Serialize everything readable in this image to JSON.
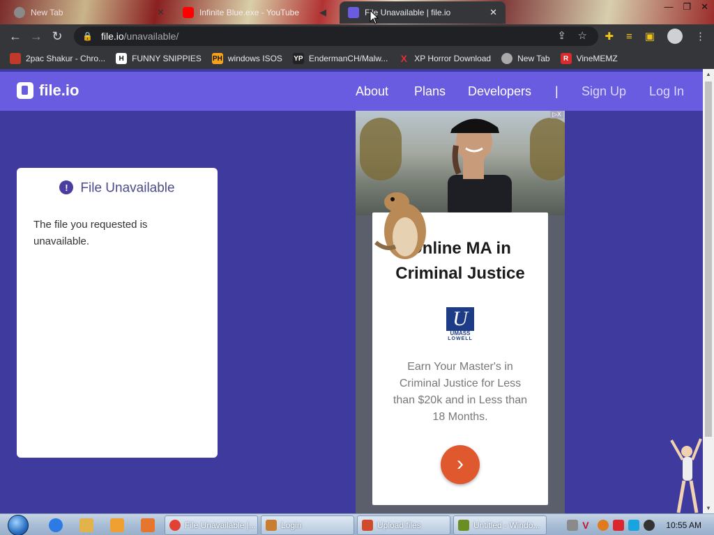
{
  "browser": {
    "tabs": [
      {
        "title": "New Tab",
        "active": false
      },
      {
        "title": "Infinite Blue.exe - YouTube",
        "active": false
      },
      {
        "title": "File Unavailable | file.io",
        "active": true
      }
    ],
    "close_glyph": "✕",
    "url_host": "file.io",
    "url_path": "/unavailable/",
    "bookmarks": [
      {
        "label": "2pac Shakur - Chro...",
        "icon": "bookmark-icon",
        "color": "#c0392b"
      },
      {
        "label": "FUNNY SNIPPIES",
        "icon": "H",
        "color": "#ffffff"
      },
      {
        "label": "windows ISOS",
        "icon": "PH",
        "color": "#f7a21b"
      },
      {
        "label": "EndermanCH/Malw...",
        "icon": "YP",
        "color": "#222222"
      },
      {
        "label": "XP Horror Download",
        "icon": "X",
        "color": "#e03030"
      },
      {
        "label": "New Tab",
        "icon": "globe-icon",
        "color": "#aaaaaa"
      },
      {
        "label": "VineMEMZ",
        "icon": "R",
        "color": "#d92b2b"
      }
    ]
  },
  "site": {
    "logo": "file.io",
    "nav": [
      "About",
      "Plans",
      "Developers",
      "|",
      "Sign Up",
      "Log In"
    ],
    "error_card": {
      "title": "File Unavailable",
      "message": "The file you requested is unavailable."
    }
  },
  "ad": {
    "adchoice": "▷X",
    "title_line1": "Online MA in",
    "title_line2": "Criminal Justice",
    "logo_top": "UMASS",
    "logo_bottom": "LOWELL",
    "logo_glyph": "U",
    "description": "Earn Your Master's in Criminal Justice for Less than $20k and in Less than 18 Months.",
    "cta_glyph": "›"
  },
  "taskbar": {
    "windows": [
      {
        "label": "File Unavailable |...",
        "icon_color": "#e34133"
      },
      {
        "label": "Login",
        "icon_color": "#c97d2e"
      },
      {
        "label": "Upload files",
        "icon_color": "#d04b2b"
      },
      {
        "label": "Untitled - Windo...",
        "icon_color": "#6b8e23"
      }
    ],
    "clock": "10:55 AM"
  }
}
